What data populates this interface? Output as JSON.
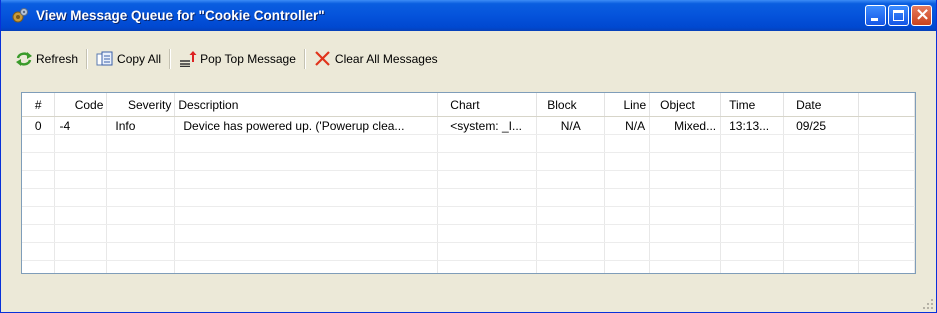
{
  "window": {
    "title": "View Message Queue for \"Cookie Controller\"",
    "icon": "gear-icon"
  },
  "toolbar": {
    "refresh_label": "Refresh",
    "copy_all_label": "Copy All",
    "pop_top_label": "Pop Top Message",
    "clear_all_label": "Clear All Messages"
  },
  "table": {
    "headers": [
      "#",
      "Code",
      "Severity",
      "Description",
      "Chart",
      "Block",
      "Line",
      "Object",
      "Time",
      "Date"
    ],
    "rows": [
      [
        "0",
        "-4",
        "Info",
        "Device has powered up. ('Powerup clea...",
        "<system: _I...",
        "N/A",
        "N/A",
        "Mixed...",
        "13:13...",
        "09/25"
      ]
    ]
  },
  "colors": {
    "titlebar": "#0553db",
    "window_bg": "#ece9d8",
    "close_button": "#c9421d"
  }
}
